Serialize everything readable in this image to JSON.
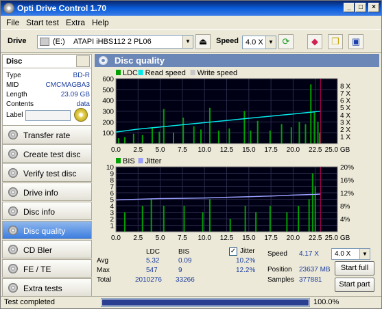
{
  "window": {
    "title": "Opti Drive Control 1.70"
  },
  "menu": [
    "File",
    "Start test",
    "Extra",
    "Help"
  ],
  "toolbar": {
    "drive_label": "Drive",
    "drive_letter": "(E:)",
    "drive_name": "ATAPI  iHBS112   2 PL06",
    "speed_label": "Speed",
    "speed_value": "4.0 X"
  },
  "disc": {
    "header": "Disc",
    "type_label": "Type",
    "type_value": "BD-R",
    "mid_label": "MID",
    "mid_value": "CMCMAGBA3",
    "length_label": "Length",
    "length_value": "23.09 GB",
    "contents_label": "Contents",
    "contents_value": "data",
    "label_label": "Label"
  },
  "nav": [
    "Transfer rate",
    "Create test disc",
    "Verify test disc",
    "Drive info",
    "Disc info",
    "Disc quality",
    "CD Bler",
    "FE / TE",
    "Extra tests"
  ],
  "nav_active_index": 5,
  "panel": {
    "title": "Disc quality"
  },
  "chart_top": {
    "legend": [
      "LDC",
      "Read speed",
      "Write speed"
    ],
    "legend_colors": [
      "#00a000",
      "#00e8e8",
      "#c8c8c8"
    ],
    "y_ticks": [
      "600",
      "500",
      "400",
      "300",
      "200",
      "100"
    ],
    "y2_ticks": [
      "8 X",
      "7 X",
      "6 X",
      "5 X",
      "4 X",
      "3 X",
      "2 X",
      "1 X"
    ],
    "x_ticks": [
      "0.0",
      "2.5",
      "5.0",
      "7.5",
      "10.0",
      "12.5",
      "15.0",
      "17.5",
      "20.0",
      "22.5",
      "25.0 GB"
    ]
  },
  "chart_bottom": {
    "legend": [
      "BIS",
      "Jitter"
    ],
    "legend_colors": [
      "#00a000",
      "#9aa0ff"
    ],
    "y_ticks": [
      "10",
      "9",
      "8",
      "7",
      "6",
      "5",
      "4",
      "3",
      "2",
      "1"
    ],
    "y2_ticks": [
      "20%",
      "16%",
      "12%",
      "8%",
      "4%"
    ],
    "x_ticks": [
      "0.0",
      "2.5",
      "5.0",
      "7.5",
      "10.0",
      "12.5",
      "15.0",
      "17.5",
      "20.0",
      "22.5",
      "25.0 GB"
    ]
  },
  "chart_data": [
    {
      "type": "bar",
      "xlabel": "",
      "ylabel": "",
      "x_range": [
        0,
        25
      ],
      "ylim": [
        0,
        600
      ],
      "y2lim": [
        0,
        9
      ],
      "series": [
        {
          "name": "LDC",
          "x": [
            0.3,
            1.0,
            2.0,
            3.0,
            4.1,
            4.9,
            5.4,
            6.5,
            7.6,
            8.8,
            9.6,
            10.6,
            11.6,
            12.8,
            14.5,
            15.2,
            16.0,
            17.4,
            18.7,
            19.8,
            20.7,
            21.4,
            22.0,
            22.4,
            22.8,
            23.0
          ],
          "values": [
            50,
            60,
            90,
            80,
            150,
            110,
            320,
            100,
            240,
            160,
            130,
            330,
            120,
            140,
            300,
            120,
            210,
            120,
            180,
            150,
            200,
            180,
            547,
            300,
            200,
            100
          ]
        },
        {
          "name": "Read speed",
          "x": [
            0.0,
            2.5,
            5.0,
            7.5,
            10.0,
            12.5,
            15.0,
            17.5,
            20.0,
            22.5,
            23.1
          ],
          "values": [
            1.6,
            2.0,
            2.3,
            2.6,
            2.9,
            3.2,
            3.5,
            3.8,
            4.1,
            4.4,
            4.5
          ]
        }
      ]
    },
    {
      "type": "bar",
      "xlabel": "",
      "ylabel": "",
      "x_range": [
        0,
        25
      ],
      "ylim": [
        0,
        10
      ],
      "y2lim": [
        0,
        20
      ],
      "series": [
        {
          "name": "BIS",
          "x": [
            1.0,
            3.0,
            4.0,
            5.4,
            7.7,
            9.8,
            10.6,
            12.9,
            14.6,
            15.8,
            17.4,
            19.3,
            20.6,
            21.8,
            22.2,
            22.5
          ],
          "values": [
            3,
            4,
            5,
            4,
            4,
            3,
            5,
            2,
            4,
            3,
            4,
            3,
            4,
            5,
            9,
            7
          ]
        },
        {
          "name": "Jitter",
          "x": [
            0.0,
            2.5,
            5.0,
            7.5,
            10.0,
            12.5,
            15.0,
            17.5,
            20.0,
            22.5,
            23.1
          ],
          "values": [
            9.8,
            10.0,
            10.2,
            10.3,
            10.4,
            10.6,
            10.8,
            11.0,
            11.3,
            11.5,
            11.6
          ]
        }
      ]
    }
  ],
  "stats": {
    "col_ldc": "LDC",
    "col_bis": "BIS",
    "avg_label": "Avg",
    "avg_ldc": "5.32",
    "avg_bis": "0.09",
    "avg_jitter": "10.2%",
    "max_label": "Max",
    "max_ldc": "547",
    "max_bis": "9",
    "max_jitter": "12.2%",
    "total_label": "Total",
    "total_ldc": "2010276",
    "total_bis": "33266",
    "jitter_label": "Jitter",
    "jitter_checked": true,
    "speed_label": "Speed",
    "speed_value": "4.17 X",
    "speed_select": "4.0 X",
    "position_label": "Position",
    "position_value": "23637 MB",
    "samples_label": "Samples",
    "samples_value": "377881",
    "start_full": "Start full",
    "start_part": "Start part"
  },
  "status": {
    "text": "Test completed",
    "progress_pct": 100,
    "progress_text": "100.0%"
  }
}
